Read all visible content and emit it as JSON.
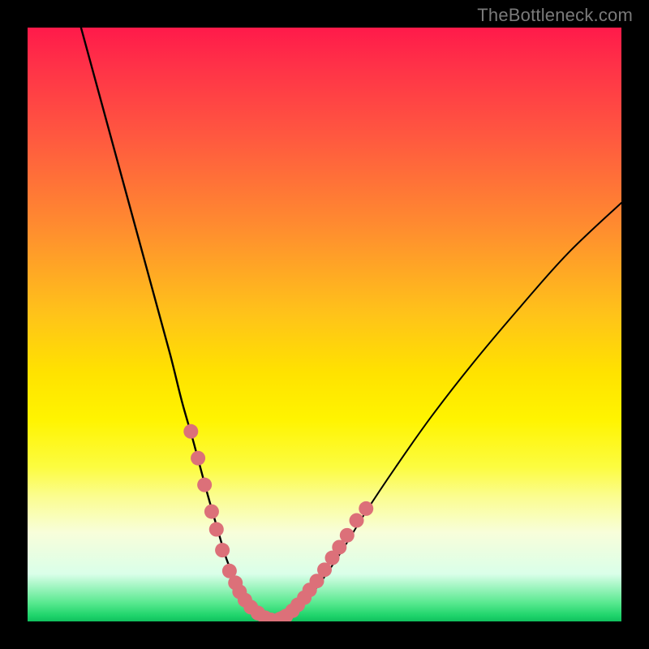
{
  "watermark": "TheBottleneck.com",
  "chart_data": {
    "type": "line",
    "title": "",
    "xlabel": "",
    "ylabel": "",
    "xlim": [
      0,
      100
    ],
    "ylim": [
      0,
      100
    ],
    "grid": false,
    "legend": false,
    "series": [
      {
        "name": "left-curve",
        "color": "#000000",
        "x": [
          9,
          12,
          15,
          18,
          21,
          24,
          26,
          28,
          30,
          32,
          33.5,
          35,
          36.5,
          38,
          40,
          42
        ],
        "values": [
          100,
          89,
          78,
          67,
          56,
          45,
          37,
          30,
          22.5,
          15.5,
          10.5,
          7,
          4.2,
          2.2,
          0.7,
          0.15
        ]
      },
      {
        "name": "right-curve",
        "color": "#000000",
        "x": [
          42,
          44,
          46,
          48,
          50,
          53,
          57,
          62,
          68,
          75,
          83,
          91,
          100
        ],
        "values": [
          0.15,
          0.9,
          2.5,
          4.8,
          7.5,
          12,
          18.5,
          26,
          34.5,
          43.5,
          53,
          62,
          70.5
        ]
      },
      {
        "name": "left-beads",
        "color": "#dc7079",
        "x": [
          27.5,
          28.7,
          29.8,
          31.0,
          31.8,
          32.8,
          34.0,
          35.0,
          35.7,
          36.6,
          37.6,
          38.8,
          40.0
        ],
        "values": [
          32.0,
          27.5,
          23.0,
          18.5,
          15.5,
          12.0,
          8.5,
          6.5,
          5.0,
          3.6,
          2.4,
          1.4,
          0.6
        ]
      },
      {
        "name": "right-beads",
        "color": "#dc7079",
        "x": [
          42.5,
          43.5,
          44.6,
          45.5,
          46.6,
          47.5,
          48.7,
          50.0,
          51.3,
          52.5,
          53.8,
          55.4,
          57.0
        ],
        "values": [
          0.4,
          0.9,
          1.8,
          2.8,
          4.0,
          5.3,
          6.8,
          8.7,
          10.7,
          12.5,
          14.5,
          17.0,
          19.0
        ]
      },
      {
        "name": "bottom-beads",
        "color": "#dc7079",
        "x": [
          38.8,
          40.0,
          41.0,
          42.0,
          43.0
        ],
        "values": [
          1.4,
          0.6,
          0.25,
          0.15,
          0.6
        ]
      }
    ],
    "bead_radius_px": 9,
    "annotations": []
  }
}
